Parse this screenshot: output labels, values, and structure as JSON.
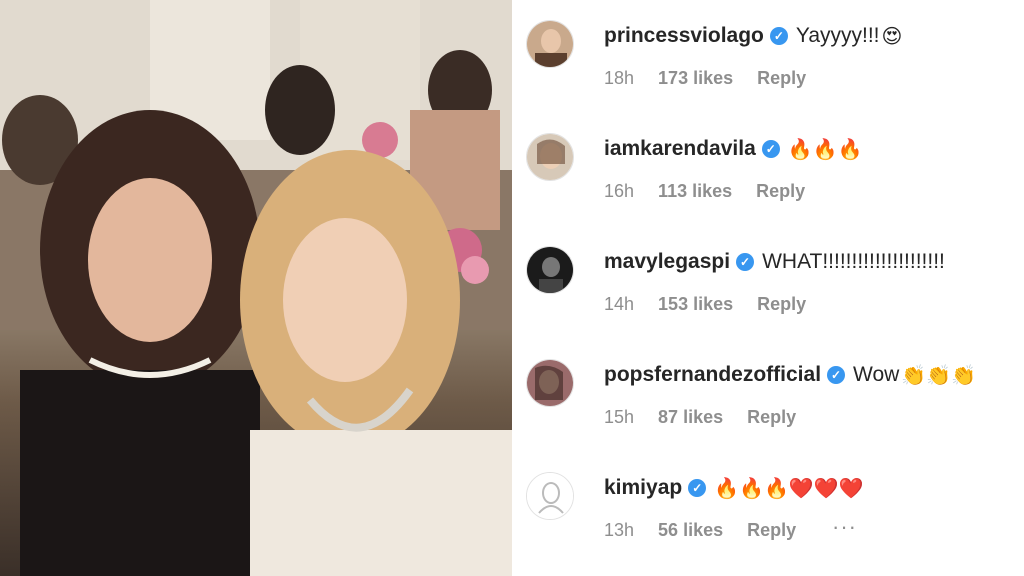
{
  "photo": {
    "description_icon": "photo-two-women"
  },
  "comments": [
    {
      "username": "princessviolago",
      "text": "Yayyyy!!!",
      "emoji": "😍",
      "time": "18h",
      "likes": "173 likes",
      "reply": "Reply"
    },
    {
      "username": "iamkarendavila",
      "text": "",
      "emoji": "🔥🔥🔥",
      "time": "16h",
      "likes": "113 likes",
      "reply": "Reply"
    },
    {
      "username": "mavylegaspi",
      "text": "WHAT!!!!!!!!!!!!!!!!!!!!!",
      "emoji": "",
      "time": "14h",
      "likes": "153 likes",
      "reply": "Reply"
    },
    {
      "username": "popsfernandezofficial",
      "text": "Wow",
      "emoji": "👏👏👏",
      "time": "15h",
      "likes": "87 likes",
      "reply": "Reply"
    },
    {
      "username": "kimiyap",
      "text": "",
      "emoji": "🔥🔥🔥❤️❤️❤️",
      "time": "13h",
      "likes": "56 likes",
      "reply": "Reply",
      "more": "···"
    }
  ],
  "colors": {
    "verified": "#3897f0",
    "text": "#262626",
    "meta": "#8e8e8e"
  }
}
